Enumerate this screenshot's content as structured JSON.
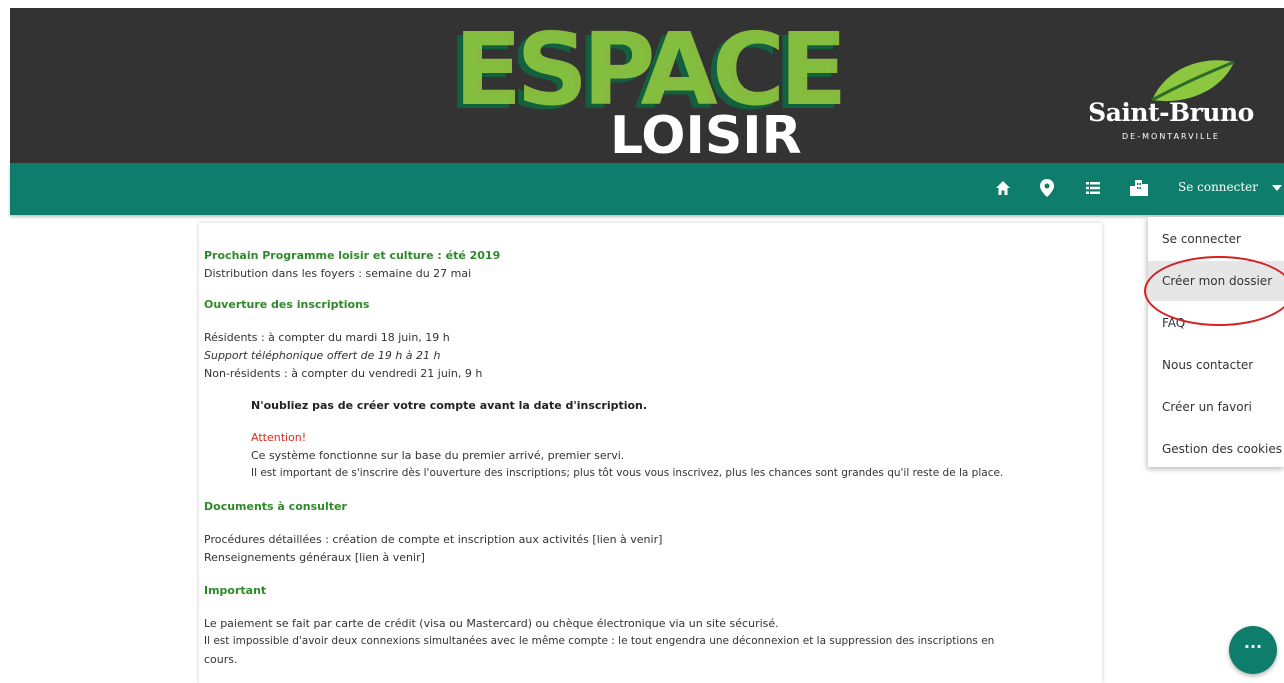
{
  "header": {
    "logo_top": "ESPACE",
    "logo_bottom": "LOISIR",
    "brand_name": "Saint-Bruno",
    "brand_sub": "DE-MONTARVILLE"
  },
  "navbar": {
    "icons": [
      "home-icon",
      "map-marker-icon",
      "list-icon",
      "city-icon"
    ],
    "login_label": "Se connecter"
  },
  "dropdown": {
    "items": [
      {
        "label": "Se connecter"
      },
      {
        "label": "Créer mon dossier"
      },
      {
        "label": "FAQ"
      },
      {
        "label": "Nous contacter"
      },
      {
        "label": "Créer un favori"
      },
      {
        "label": "Gestion des cookies"
      }
    ],
    "highlighted": "Créer mon dossier"
  },
  "content": {
    "prog_title": "Prochain Programme loisir et culture : été 2019",
    "distribution": "Distribution dans les foyers : semaine du 27 mai",
    "ouverture_title": "Ouverture des inscriptions",
    "residents": "Résidents : à compter du mardi 18 juin, 19 h",
    "support": "Support téléphonique offert de 19 h à 21 h",
    "non_residents": "Non-résidents : à compter du vendredi 21 juin, 9 h",
    "reminder": "N'oubliez pas de créer votre compte avant la date d'inscription.",
    "attention": "Attention!",
    "system": "Ce système fonctionne sur la base du premier arrivé, premier servi.",
    "important_note": "Il est important de s'inscrire dès l'ouverture des inscriptions; plus tôt vous vous inscrivez, plus les chances sont grandes qu'il reste de la place.",
    "documents_title": "Documents à consulter",
    "procedures": "Procédures détaillées : création de compte et inscription aux activités [lien à venir]",
    "renseignements": "Renseignements généraux [lien à venir]",
    "important_title": "Important",
    "paiement": "Le paiement se fait par carte de crédit (visa ou Mastercard) ou chèque électronique via un site sécurisé.",
    "connexions": "Il est impossible d'avoir deux connexions simultanées avec le même compte : le tout engendra une déconnexion et la suppression des inscriptions en",
    "cours": "cours."
  },
  "fab": {
    "label": "···"
  },
  "colors": {
    "header_bg": "#333333",
    "nav_bg": "#0e7d6c",
    "section_title": "#2e8a28",
    "attention": "#e0261a",
    "highlight_circle": "#d42020"
  }
}
